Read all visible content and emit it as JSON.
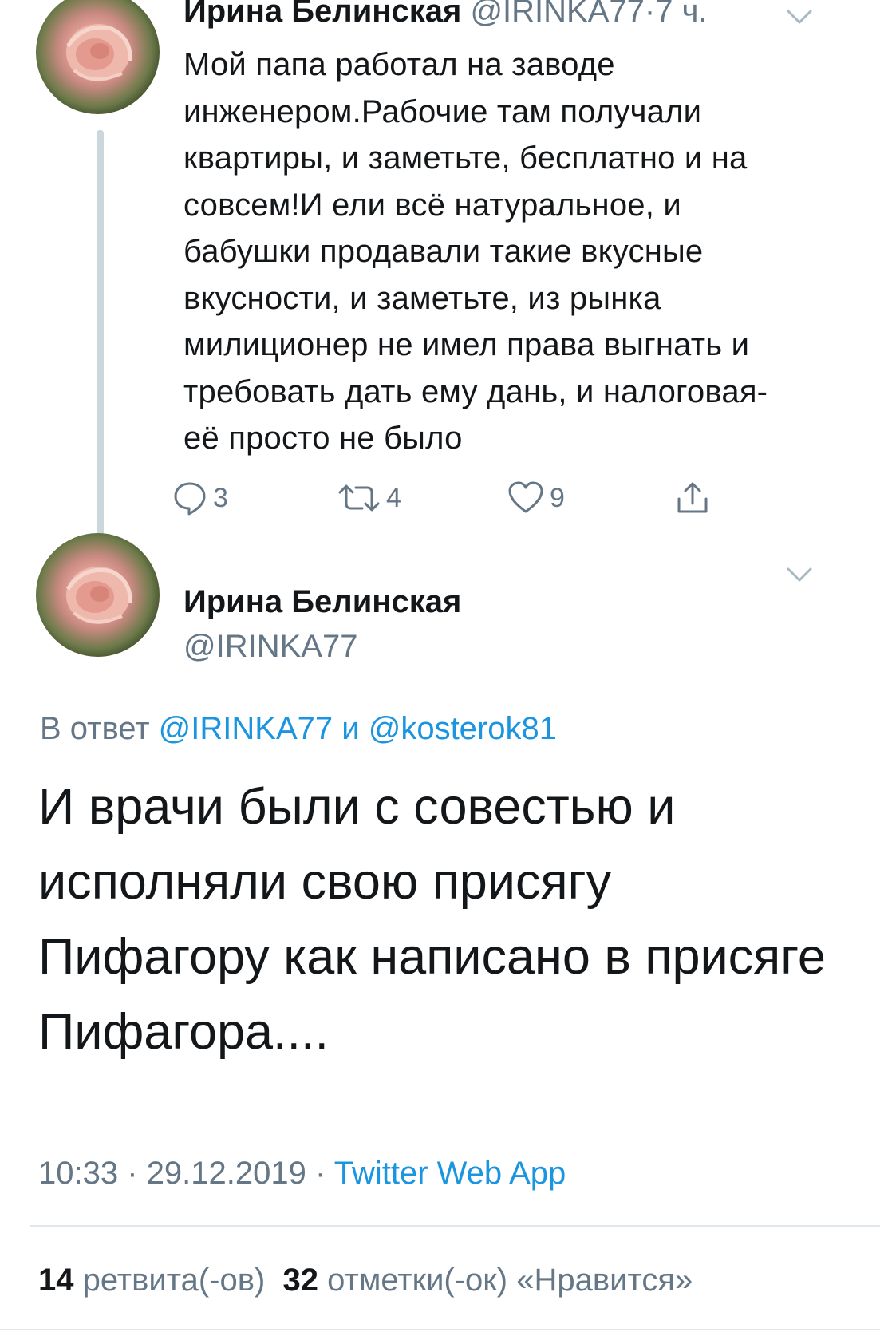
{
  "parent_tweet": {
    "author_name": "Ирина Белинская",
    "author_handle": "@IRINKA77",
    "separator": "·",
    "time_ago": "7 ч.",
    "text": "Мой папа работал на заводе\nинженером.Рабочие там получали\nквартиры, и заметьте, бесплатно и на\nсовсем!И ели всё натуральное, и\nбабушки продавали такие вкусные\nвкусности, и заметьте, из рынка\nмилиционер не имел права выгнать и\nтребовать дать ему дань, и налоговая-\nеё просто не было",
    "actions": {
      "reply_icon": "reply-icon",
      "reply_count": "3",
      "retweet_icon": "retweet-icon",
      "retweet_count": "4",
      "like_icon": "heart-icon",
      "like_count": "9",
      "share_icon": "share-icon"
    }
  },
  "main_tweet": {
    "author_name": "Ирина Белинская",
    "author_handle": "@IRINKA77",
    "reply_prefix": "В ответ",
    "reply_user_1": "@IRINKA77",
    "reply_conjunction": "и",
    "reply_user_2": "@kosterok81",
    "text": "И врачи были с совестью и\nисполняли свою присягу\nПифагору как написано в присяге\nПифагора....",
    "time": "10:33",
    "date": "29.12.2019",
    "separator": "·",
    "source": "Twitter Web App",
    "retweets_count": "14",
    "retweets_label": "ретвита(-ов)",
    "likes_count": "32",
    "likes_label": "отметки(-ок) «Нравится»"
  },
  "colors": {
    "text": "#14171a",
    "secondary": "#657786",
    "link": "#1b95e0",
    "divider": "#e1e8ed",
    "thread_line": "#ccd6dd"
  }
}
